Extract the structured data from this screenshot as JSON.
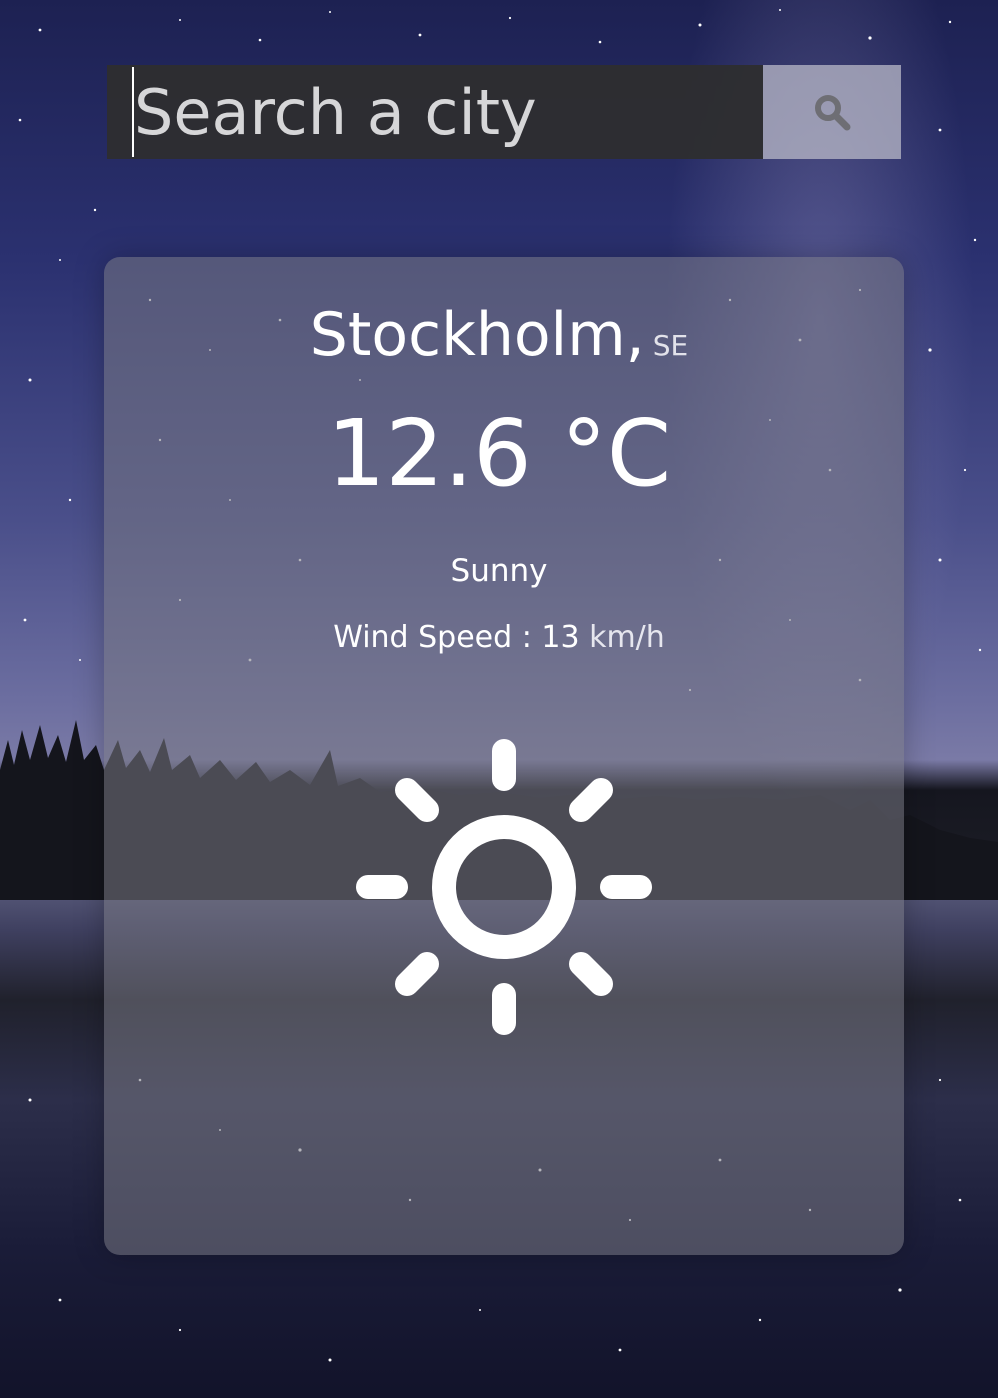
{
  "search": {
    "placeholder": "Search a city",
    "value": "",
    "button_icon": "search-icon"
  },
  "weather": {
    "city": "Stockholm,",
    "country": "SE",
    "temperature": "12.6 °C",
    "condition": "Sunny",
    "wind_label": "Wind Speed : 13",
    "wind_unit": "km/h",
    "icon": "sun-icon"
  },
  "colors": {
    "text": "#ffffff",
    "search_bar": "#2e2e30",
    "search_button": "#b9b9c8",
    "search_icon": "#6e6e74",
    "card": "#787884"
  }
}
